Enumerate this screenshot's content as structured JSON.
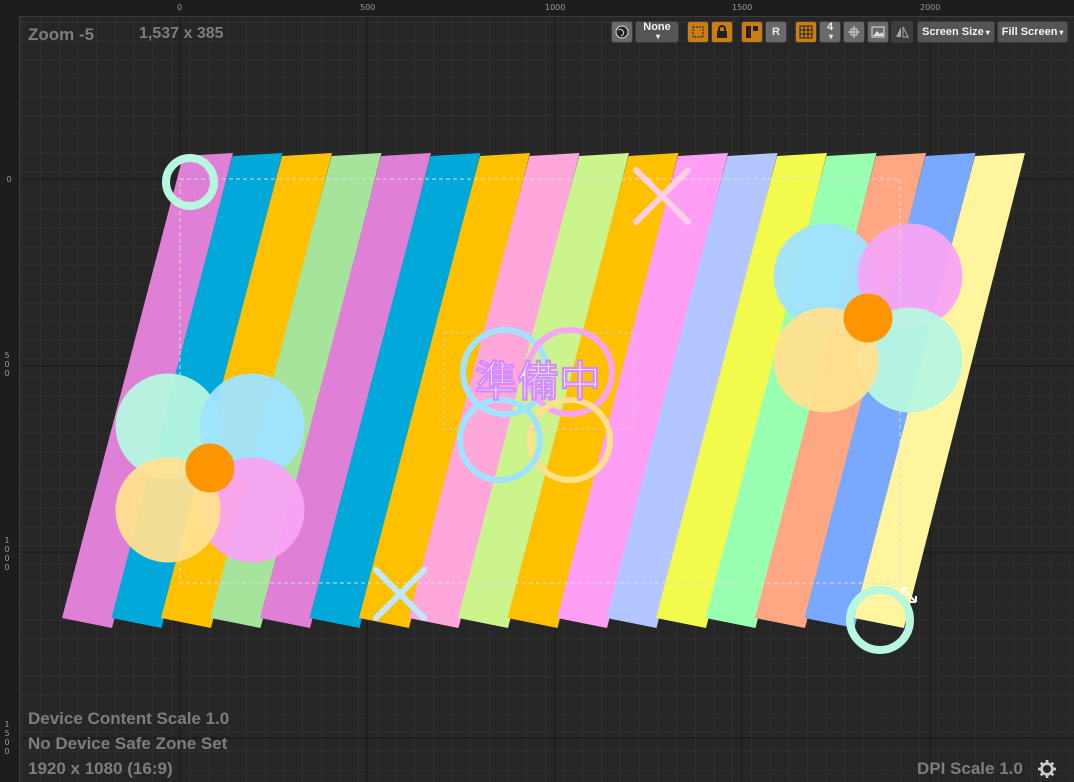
{
  "status": {
    "zoom": "Zoom -5",
    "resolution": "1,537 x 385",
    "device_content_scale": "Device Content Scale 1.0",
    "safe_zone": "No Device Safe Zone Set",
    "screen_resolution": "1920 x 1080 (16:9)",
    "dpi_scale": "DPI Scale 1.0"
  },
  "ruler": {
    "top_labels": [
      "0",
      "500",
      "1000",
      "1500",
      "2000"
    ],
    "left_labels": [
      "0",
      "500",
      "1000",
      "1500"
    ]
  },
  "toolbar": {
    "world_icon": "globe-icon",
    "none_label": "None",
    "grid_snap_value": "4",
    "r_label": "R",
    "screen_size_label": "Screen Size",
    "fill_screen_label": "Fill Screen"
  },
  "canvas": {
    "title_text": "準備中",
    "stripe_colors": [
      "#e07fd6",
      "#00a9da",
      "#ffc000",
      "#a6e49c",
      "#e07fd6",
      "#00a9da",
      "#ffc000",
      "#ffa6da",
      "#ccf48d",
      "#ffc000",
      "#ff9ef5",
      "#b3c6ff",
      "#f2fa4c",
      "#99ffb1",
      "#ffa682",
      "#78a9ff",
      "#fff59e"
    ],
    "accent_colors": {
      "flower_pink": "#f8a4f6",
      "flower_blue": "#9fe3ff",
      "flower_yellow": "#ffe08f",
      "flower_mint": "#b7f7e0",
      "center_orange": "#ff9500",
      "selection_orange": "#ff8a00"
    }
  }
}
